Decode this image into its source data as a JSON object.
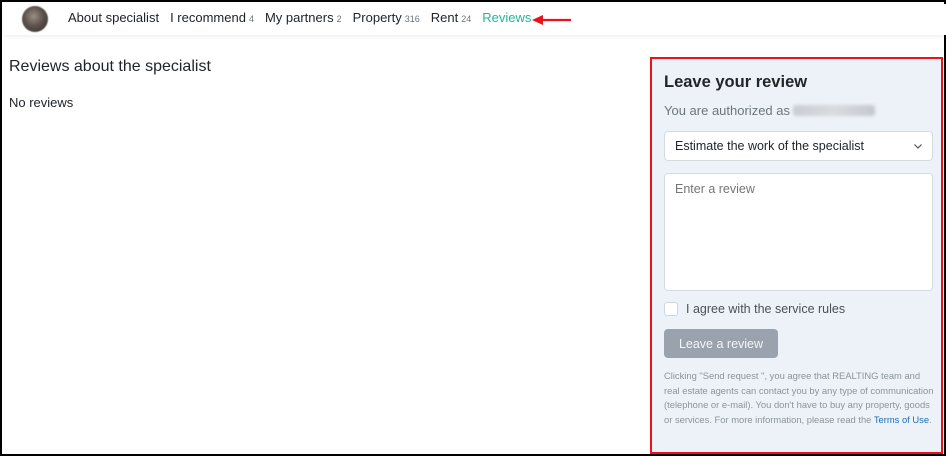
{
  "nav": {
    "items": [
      {
        "label": "About specialist",
        "count": ""
      },
      {
        "label": "I recommend",
        "count": "4"
      },
      {
        "label": "My partners",
        "count": "2"
      },
      {
        "label": "Property",
        "count": "316"
      },
      {
        "label": "Rent",
        "count": "24"
      },
      {
        "label": "Reviews",
        "count": ""
      }
    ],
    "active_color": "#1fb89a",
    "annotation_arrow_color": "#e8141b",
    "avatar_icon": "user-avatar-blurred"
  },
  "main": {
    "title": "Reviews about the specialist",
    "empty_text": "No reviews"
  },
  "review_form": {
    "title": "Leave your review",
    "authorized_text": "You are authorized as",
    "select_value": "Estimate the work of the specialist",
    "review_placeholder": "Enter a review",
    "agree_label": "I agree with the service rules",
    "submit_label": "Leave a review",
    "disclaimer": "Clicking \"Send request \", you agree that REALTING team and real estate agents can contact you by any type of communication (telephone or e-mail). You don't have to buy any property, goods or services. For more information, please read the",
    "terms_link": "Terms of Use",
    "highlight_color": "#e8141b",
    "panel_background": "#edf2f8"
  }
}
